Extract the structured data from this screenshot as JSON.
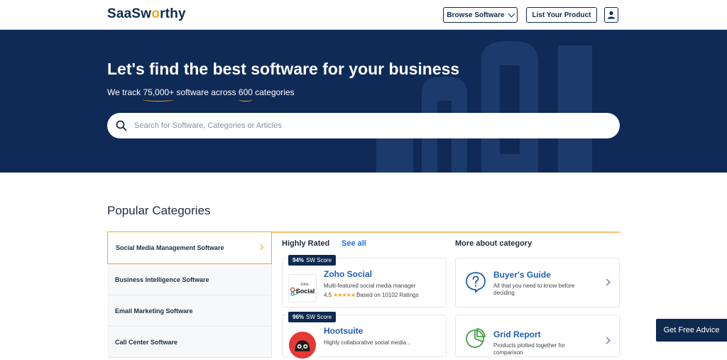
{
  "header": {
    "logo_pre": "SaaSw",
    "logo_o": "o",
    "logo_post": "rthy",
    "browse_label": "Browse Software",
    "list_label": "List Your Product"
  },
  "hero": {
    "title": "Let's find the best software for your business",
    "sub_pre": "We track ",
    "sub_count": "75,000+",
    "sub_mid": " software across ",
    "sub_cats": "600",
    "sub_post": " categories",
    "search_placeholder": "Search for Software, Categories or Articles"
  },
  "popular": {
    "title": "Popular Categories",
    "categories": [
      "Social Media Management Software",
      "Business Intelligence Software",
      "Email Marketing Software",
      "Call Center Software"
    ],
    "highly_rated": "Highly Rated",
    "see_all": "See all",
    "more_about": "More about category",
    "products": [
      {
        "score": "94%",
        "score_label": "SW Score",
        "name": "Zoho Social",
        "desc": "Multi-featured social media manager",
        "rating": "4.5",
        "stars": "★★★★★",
        "ratings_text": "Based on 10102 Ratings",
        "logo_top": "Zoho",
        "logo_main": "Social"
      },
      {
        "score": "96%",
        "score_label": "SW Score",
        "name": "Hootsuite",
        "desc": "Highly collaborative social media..."
      }
    ],
    "more": [
      {
        "title": "Buyer's Guide",
        "desc": "All that you need to know before deciding",
        "icon": "question-bubble-icon"
      },
      {
        "title": "Grid Report",
        "desc": "Products plotted together for comparison",
        "icon": "pie-chart-icon"
      }
    ]
  },
  "advice_label": "Get Free Advice",
  "colors": {
    "navy": "#0f2a57",
    "accent": "#f5a623",
    "link": "#1f5fb5"
  }
}
